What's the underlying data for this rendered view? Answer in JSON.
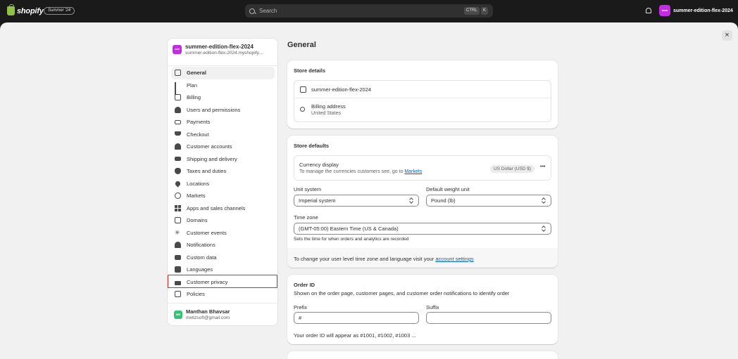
{
  "topbar": {
    "brand": "shopify",
    "season_badge": "Summer '24",
    "search_placeholder": "Search",
    "kbd_ctrl": "CTRL",
    "kbd_k": "K",
    "store_name": "summer-edition-flex-2024",
    "store_avatar_text": "sum"
  },
  "sidebar": {
    "store_name": "summer-edition-flex-2024",
    "store_domain": "summer-edition-flex-2024.myshopify....",
    "avatar_text": "sum",
    "items": [
      {
        "label": "General",
        "icon": "store-icon"
      },
      {
        "label": "Plan",
        "icon": "chart-bars-icon"
      },
      {
        "label": "Billing",
        "icon": "receipt-icon"
      },
      {
        "label": "Users and permissions",
        "icon": "users-icon"
      },
      {
        "label": "Payments",
        "icon": "payments-icon"
      },
      {
        "label": "Checkout",
        "icon": "cart-icon"
      },
      {
        "label": "Customer accounts",
        "icon": "person-icon"
      },
      {
        "label": "Shipping and delivery",
        "icon": "truck-icon"
      },
      {
        "label": "Taxes and duties",
        "icon": "tax-icon"
      },
      {
        "label": "Locations",
        "icon": "location-pin-icon"
      },
      {
        "label": "Markets",
        "icon": "globe-icon"
      },
      {
        "label": "Apps and sales channels",
        "icon": "apps-grid-icon"
      },
      {
        "label": "Domains",
        "icon": "domains-icon"
      },
      {
        "label": "Customer events",
        "icon": "sparkle-icon"
      },
      {
        "label": "Notifications",
        "icon": "bell-icon"
      },
      {
        "label": "Custom data",
        "icon": "database-icon"
      },
      {
        "label": "Languages",
        "icon": "language-icon"
      },
      {
        "label": "Customer privacy",
        "icon": "lock-icon"
      },
      {
        "label": "Policies",
        "icon": "policies-icon"
      }
    ],
    "user_name": "Manthan Bhavsar",
    "user_email": "metizsoft@gmail.com",
    "user_avatar_text": "MB"
  },
  "main": {
    "title": "General",
    "store_details": {
      "title": "Store details",
      "store_name": "summer-edition-flex-2024",
      "billing_label": "Billing address",
      "billing_country": "United States"
    },
    "store_defaults": {
      "title": "Store defaults",
      "currency_label": "Currency display",
      "currency_desc": "To manage the currencies customers see, go to",
      "currency_link": "Markets",
      "currency_value": "US Dollar (USD $)",
      "more": "•••",
      "unit_label": "Unit system",
      "unit_value": "Imperial system",
      "weight_label": "Default weight unit",
      "weight_value": "Pound (lb)",
      "timezone_label": "Time zone",
      "timezone_value": "(GMT-05:00) Eastern Time (US & Canada)",
      "timezone_help": "Sets the time for when orders and analytics are recorded",
      "footer_text": "To change your user level time zone and language visit your",
      "footer_link": "account settings"
    },
    "order_id": {
      "title": "Order ID",
      "desc": "Shown on the order page, customer pages, and customer order notifications to identify order",
      "prefix_label": "Prefix",
      "prefix_value": "#",
      "suffix_label": "Suffix",
      "suffix_value": "",
      "preview": "Your order ID will appear as #1001, #1002, #1003 ..."
    }
  }
}
